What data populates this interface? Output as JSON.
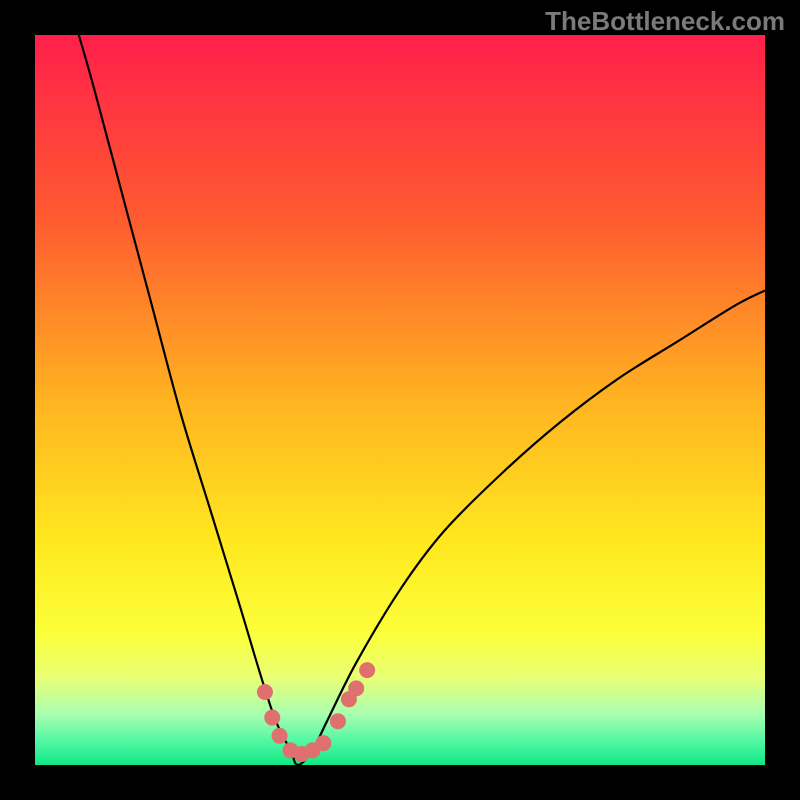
{
  "watermark": "TheBottleneck.com",
  "chart_data": {
    "type": "line",
    "title": "",
    "xlabel": "",
    "ylabel": "",
    "xlim": [
      0,
      100
    ],
    "ylim": [
      0,
      100
    ],
    "bottleneck_x": 36,
    "curve": {
      "left_branch": [
        {
          "x": 6,
          "y": 100
        },
        {
          "x": 8,
          "y": 93
        },
        {
          "x": 12,
          "y": 78
        },
        {
          "x": 16,
          "y": 63
        },
        {
          "x": 20,
          "y": 48
        },
        {
          "x": 24,
          "y": 35
        },
        {
          "x": 28,
          "y": 22
        },
        {
          "x": 31,
          "y": 12
        },
        {
          "x": 33,
          "y": 6
        },
        {
          "x": 35,
          "y": 2
        },
        {
          "x": 36,
          "y": 0
        }
      ],
      "right_branch": [
        {
          "x": 36,
          "y": 0
        },
        {
          "x": 38,
          "y": 2
        },
        {
          "x": 40,
          "y": 6
        },
        {
          "x": 44,
          "y": 14
        },
        {
          "x": 50,
          "y": 24
        },
        {
          "x": 56,
          "y": 32
        },
        {
          "x": 64,
          "y": 40
        },
        {
          "x": 72,
          "y": 47
        },
        {
          "x": 80,
          "y": 53
        },
        {
          "x": 88,
          "y": 58
        },
        {
          "x": 96,
          "y": 63
        },
        {
          "x": 100,
          "y": 65
        }
      ]
    },
    "markers": [
      {
        "x": 31.5,
        "y": 10
      },
      {
        "x": 32.5,
        "y": 6.5
      },
      {
        "x": 33.5,
        "y": 4
      },
      {
        "x": 35,
        "y": 2
      },
      {
        "x": 36.5,
        "y": 1.5
      },
      {
        "x": 38,
        "y": 2
      },
      {
        "x": 39.5,
        "y": 3
      },
      {
        "x": 41.5,
        "y": 6
      },
      {
        "x": 43,
        "y": 9
      },
      {
        "x": 44,
        "y": 10.5
      },
      {
        "x": 45.5,
        "y": 13
      }
    ],
    "gradient_stops": [
      {
        "offset": 0,
        "color": "#ff1f4b"
      },
      {
        "offset": 25,
        "color": "#ff5a30"
      },
      {
        "offset": 50,
        "color": "#ffb321"
      },
      {
        "offset": 70,
        "color": "#ffe91f"
      },
      {
        "offset": 82,
        "color": "#fbff3a"
      },
      {
        "offset": 88,
        "color": "#e9ff75"
      },
      {
        "offset": 93,
        "color": "#a9ffb0"
      },
      {
        "offset": 97,
        "color": "#4cf6a2"
      },
      {
        "offset": 100,
        "color": "#10e884"
      }
    ]
  }
}
